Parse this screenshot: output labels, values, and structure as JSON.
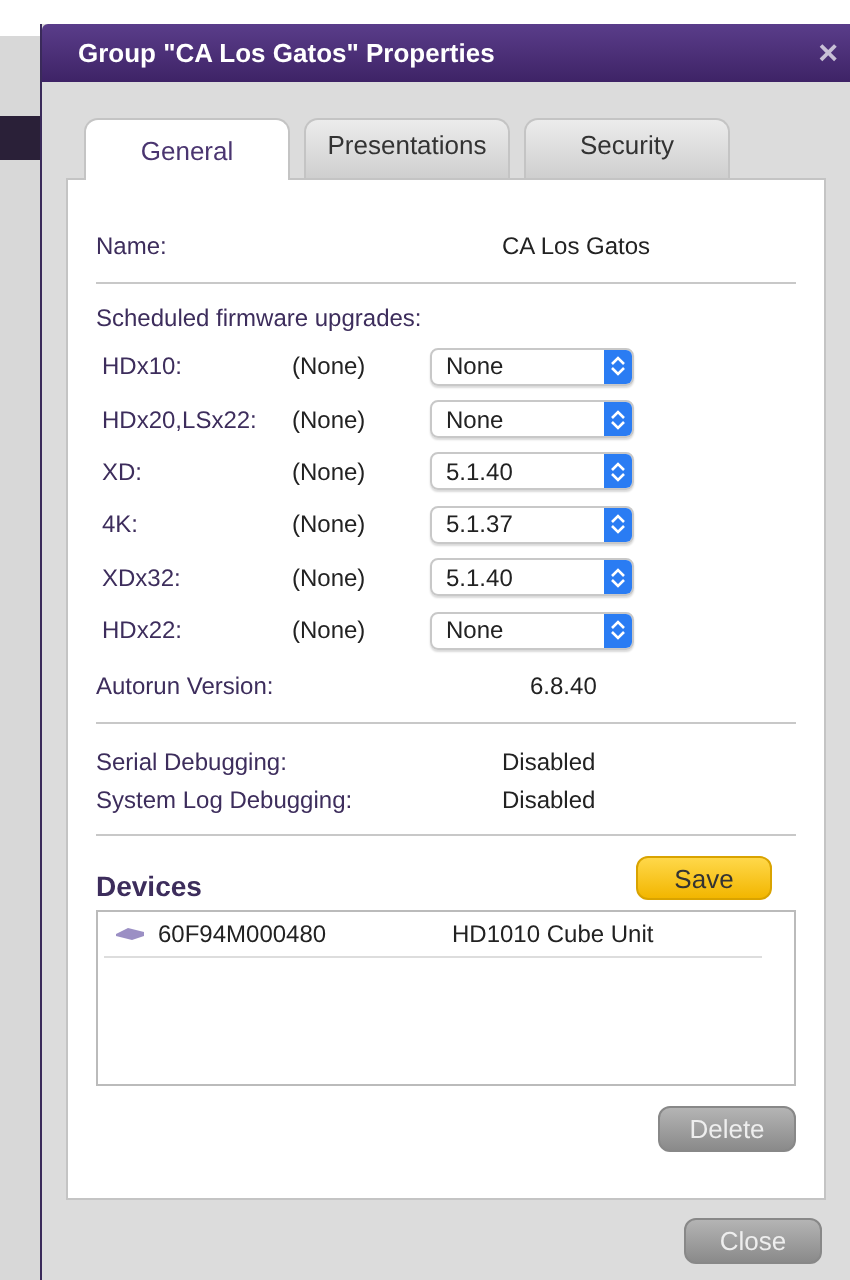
{
  "window": {
    "title": "Group \"CA Los Gatos\" Properties",
    "close": "×"
  },
  "tabs": [
    {
      "label": "General",
      "selected": true
    },
    {
      "label": "Presentations",
      "selected": false
    },
    {
      "label": "Security",
      "selected": false
    }
  ],
  "name": {
    "label": "Name:",
    "value": "CA Los Gatos"
  },
  "firmware": {
    "heading": "Scheduled firmware upgrades:",
    "rows": [
      {
        "model": "HDx10:",
        "current": "(None)",
        "value": "None"
      },
      {
        "model": "HDx20,LSx22:",
        "current": "(None)",
        "value": "None"
      },
      {
        "model": "XD:",
        "current": "(None)",
        "value": "5.1.40"
      },
      {
        "model": "4K:",
        "current": "(None)",
        "value": "5.1.37"
      },
      {
        "model": "XDx32:",
        "current": "(None)",
        "value": "5.1.40"
      },
      {
        "model": "HDx22:",
        "current": "(None)",
        "value": "None"
      }
    ]
  },
  "autorun": {
    "label": "Autorun Version:",
    "value": "6.8.40"
  },
  "debugging": [
    {
      "label": "Serial Debugging:",
      "value": "Disabled"
    },
    {
      "label": "System Log Debugging:",
      "value": "Disabled"
    }
  ],
  "devices": {
    "heading": "Devices",
    "save": "Save",
    "rows": [
      {
        "serial": "60F94M000480",
        "model": "HD1010 Cube Unit"
      }
    ],
    "delete": "Delete"
  },
  "buttons": {
    "close": "Close"
  }
}
